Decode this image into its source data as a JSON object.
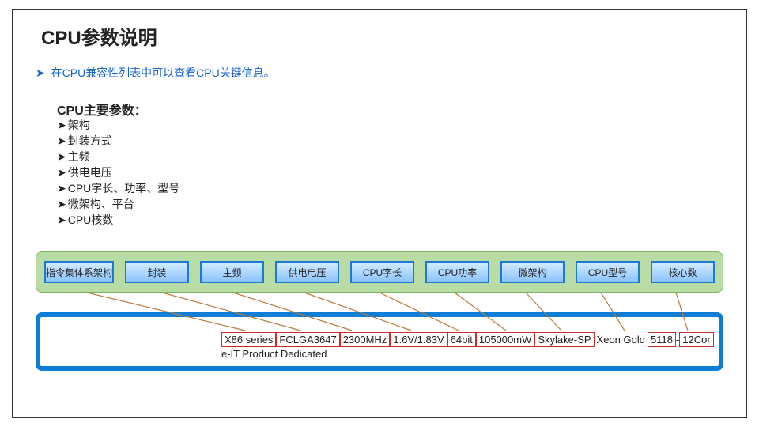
{
  "title": "CPU参数说明",
  "intro": "在CPU兼容性列表中可以查看CPU关键信息。",
  "paramsTitle": "CPU主要参数：",
  "params": [
    "架构",
    "封装方式",
    "主频",
    "供电电压",
    "CPU字长、功率、型号",
    "微架构、平台",
    "CPU核数"
  ],
  "headers": [
    "指令集体系架构",
    "封装",
    "主频",
    "供电电压",
    "CPU字长",
    "CPU功率",
    "微架构",
    "CPU型号",
    "核心数"
  ],
  "cpuValues": [
    "X86 series",
    "FCLGA3647",
    "2300MHz",
    "1.6V/1.83V",
    "64bit",
    "105000mW",
    "Skylake-SP",
    "Xeon Gold",
    "5118",
    "12Cor"
  ],
  "trailText": "e-IT Product Dedicated",
  "chevron": "➤"
}
